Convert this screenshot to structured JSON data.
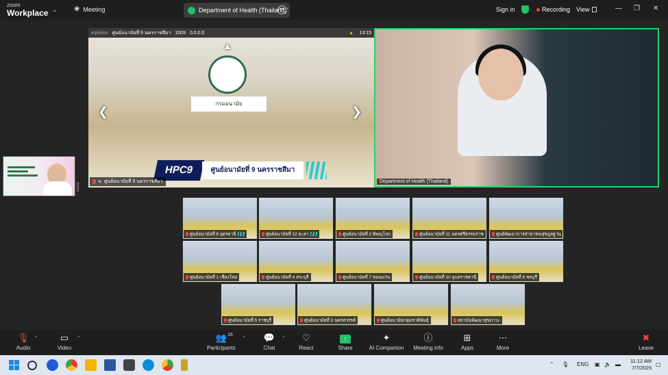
{
  "titlebar": {
    "logo_line1": "zoom",
    "logo_line2": "Workplace",
    "meeting_label": "Meeting",
    "tab_title": "Department of Health (Thailand)'",
    "sign_in": "Sign in",
    "recording": "Recording",
    "view": "View"
  },
  "stage": {
    "left_video": {
      "osd_brand": "equinox",
      "osd_name": "ศูนย์อนามัยที่ 9 นครราชสีมา",
      "osd_code": "1009",
      "osd_ip": "0.0.0.0",
      "osd_time": "13:15",
      "banner_code": "HPC9",
      "banner_text": "ศูนย์อนามัยที่ 9 นครราชสีมา",
      "sign_text": "กรมอนามัย",
      "label": "ศูนย์อนามัยที่ 9 นครราชสีมา"
    },
    "right_video": {
      "label": "Department of Health (Thailand)"
    }
  },
  "gallery": {
    "tiles": [
      {
        "label": "ศูนย์อนามัยที่ 8 อุดรธานี"
      },
      {
        "label": "ศูนย์อนามัยที่ 12 ยะลา"
      },
      {
        "label": "ศูนย์อนามัยที่ 2 พิษณุโลก"
      },
      {
        "label": "ศูนย์อนามัยที่ 11 นครศรีธรรมราช"
      },
      {
        "label": "ศูนย์พัฒนาการสาธารณสุขมูลฐาน"
      },
      {
        "label": "ศูนย์อนามัยที่ 1 เชียงใหม่"
      },
      {
        "label": "ศูนย์อนามัยที่ 4 สระบุรี"
      },
      {
        "label": "ศูนย์อนามัยที่ 7 ขอนแก่น"
      },
      {
        "label": "ศูนย์อนามัยที่ 10 อุบลราชธานี"
      },
      {
        "label": "ศูนย์อนามัยที่ 6 ชลบุรี"
      },
      {
        "label": "ศูนย์อนามัยที่ 5 ราชบุรี"
      },
      {
        "label": "ศูนย์อนามัยที่ 3 นครสวรรค์"
      },
      {
        "label": "ศูนย์อนามัยกลุ่มชาติพันธุ์"
      },
      {
        "label": "สถาบันพัฒนาสุขภาวะ"
      }
    ]
  },
  "toolbar": {
    "audio": "Audio",
    "video": "Video",
    "participants": "Participants",
    "participants_count": "16",
    "chat": "Chat",
    "react": "React",
    "share": "Share",
    "ai_companion": "AI Companion",
    "meeting_info": "Meeting info",
    "apps": "Apps",
    "more": "More",
    "leave": "Leave"
  },
  "taskbar": {
    "lang": "ENG",
    "time": "11:12 AM",
    "date": "7/7/2025"
  },
  "colors": {
    "active_speaker": "#25d36a",
    "share_green": "#23c16b",
    "recording_red": "#ef4444",
    "banner_navy": "#0f1d5a"
  }
}
